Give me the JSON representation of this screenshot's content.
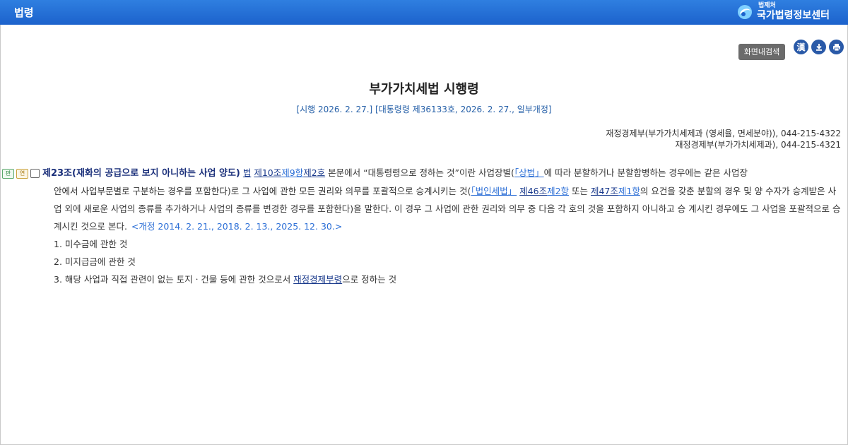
{
  "topbar": {
    "title": "법령",
    "logo_sub": "법제처",
    "logo_main": "국가법령정보센터"
  },
  "tools": {
    "screen_search": "화면내검색",
    "hanja": "漢"
  },
  "law": {
    "title": "부가가치세법 시행령",
    "meta": "[시행 2026. 2. 27.] [대통령령 제36133호, 2026. 2. 27., 일부개정]",
    "dept_line1": "재정경제부(부가가치세제과 (영세율, 면세분야)), 044-215-4322",
    "dept_line2": "재정경제부(부가가치세제과), 044-215-4321"
  },
  "article": {
    "badge_pan": "판",
    "badge_yeon": "연",
    "title": "제23조(재화의 공급으로 보지 아니하는 사업 양도)",
    "link_law": "법",
    "link_art10": "제10조",
    "link_par9": "제9항",
    "link_no2": "제2호",
    "text1": " 본문에서 “대통령령으로 정하는 것”이란 사업장별(",
    "link_sangbeop": "「상법」",
    "text2": "에 따라 분할하거나 분할합병하는 경우에는 같은 사업장",
    "text3": "안에서 사업부문별로 구분하는 경우를 포함한다)로 그 사업에 관한 모든 권리와 의무를 포괄적으로 승계시키는 것(",
    "link_corp": "「법인세법」",
    "link_art46": "제46조",
    "link_par2": "제2항",
    "text4": " 또는 ",
    "link_art47": "제47조",
    "link_par1": "제1항",
    "text5": "의 요건을 갖춘 분할의 경우 및 양",
    "text6": "수자가 승계받은 사업 외에 새로운 사업의 종류를 추가하거나 사업의 종류를 변경한 경우를 포함한다)을 말한다. 이 경우 그 사업에 관한 권리와 의무 중 다음 각 호의 것을 포함하지 아니하고 승",
    "text7": "계시킨 경우에도 그 사업을 포괄적으로 승계시킨 것으로 본다.",
    "amend": "<개정 2014. 2. 21., 2018. 2. 13., 2025. 12. 30.>",
    "item1": "1. 미수금에 관한 것",
    "item2": "2. 미지급금에 관한 것",
    "item3_pre": "3. 해당 사업과 직접 관련이 없는 토지ㆍ건물 등에 관한 것으로서 ",
    "item3_link": "재정경제부령",
    "item3_post": "으로 정하는 것"
  },
  "colors": {
    "topbar": "#1c62cc",
    "article_title": "#1a2f7a",
    "link_blue": "#2b6ed6",
    "meta": "#2660a8"
  }
}
